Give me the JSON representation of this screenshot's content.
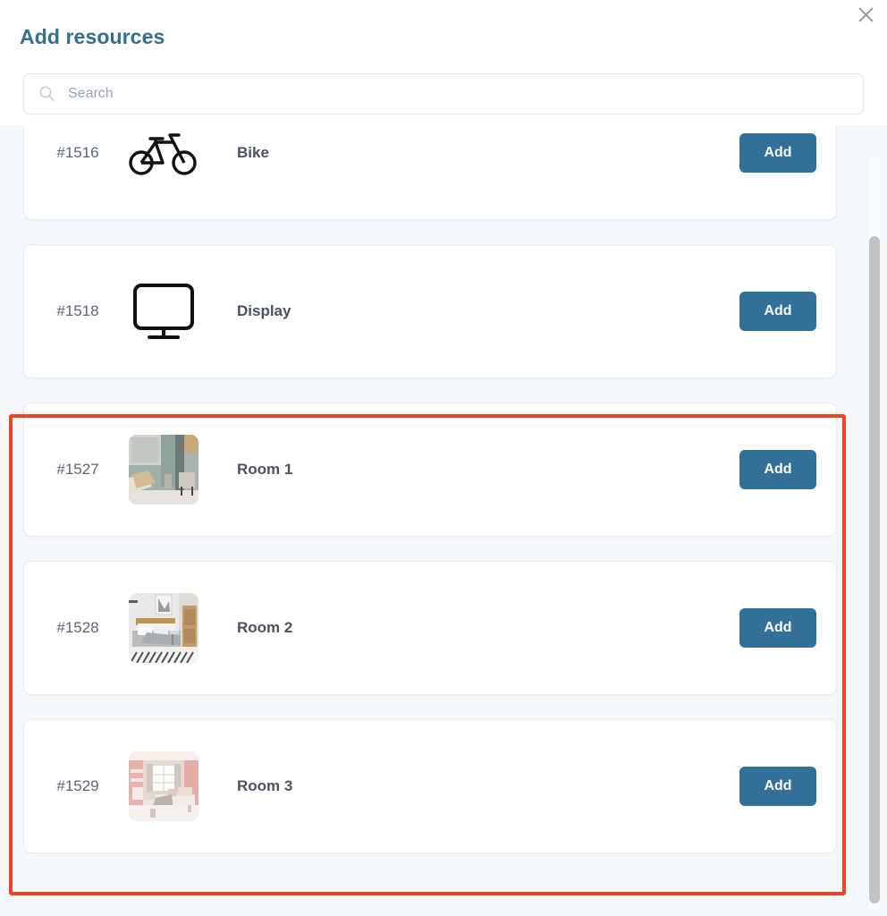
{
  "dialog": {
    "title": "Add resources",
    "close_label": "×",
    "close_icon": "close-icon"
  },
  "search": {
    "placeholder": "Search",
    "value": "",
    "icon": "search-icon"
  },
  "resources": [
    {
      "id": "#1516",
      "name": "Bike",
      "thumb_type": "icon",
      "icon": "bicycle-icon",
      "action_label": "Add"
    },
    {
      "id": "#1518",
      "name": "Display",
      "thumb_type": "icon",
      "icon": "monitor-icon",
      "action_label": "Add"
    },
    {
      "id": "#1527",
      "name": "Room 1",
      "thumb_type": "photo",
      "icon": "room-photo-living-room",
      "action_label": "Add"
    },
    {
      "id": "#1528",
      "name": "Room 2",
      "thumb_type": "photo",
      "icon": "room-photo-gray-bedroom",
      "action_label": "Add"
    },
    {
      "id": "#1529",
      "name": "Room 3",
      "thumb_type": "photo",
      "icon": "room-photo-pink-bedroom",
      "action_label": "Add"
    }
  ],
  "colors": {
    "title": "#31708f",
    "accent_button": "#337099",
    "highlight": "#ef4424",
    "list_background": "#f5f8fb",
    "card_background": "#ffffff",
    "scrollbar_thumb": "#c2c2c2"
  },
  "scrollbar": {
    "visible": true,
    "thumb_position": "middle"
  },
  "annotation": {
    "type": "highlight-rectangle",
    "covers": [
      "#1527",
      "#1528",
      "#1529"
    ]
  }
}
